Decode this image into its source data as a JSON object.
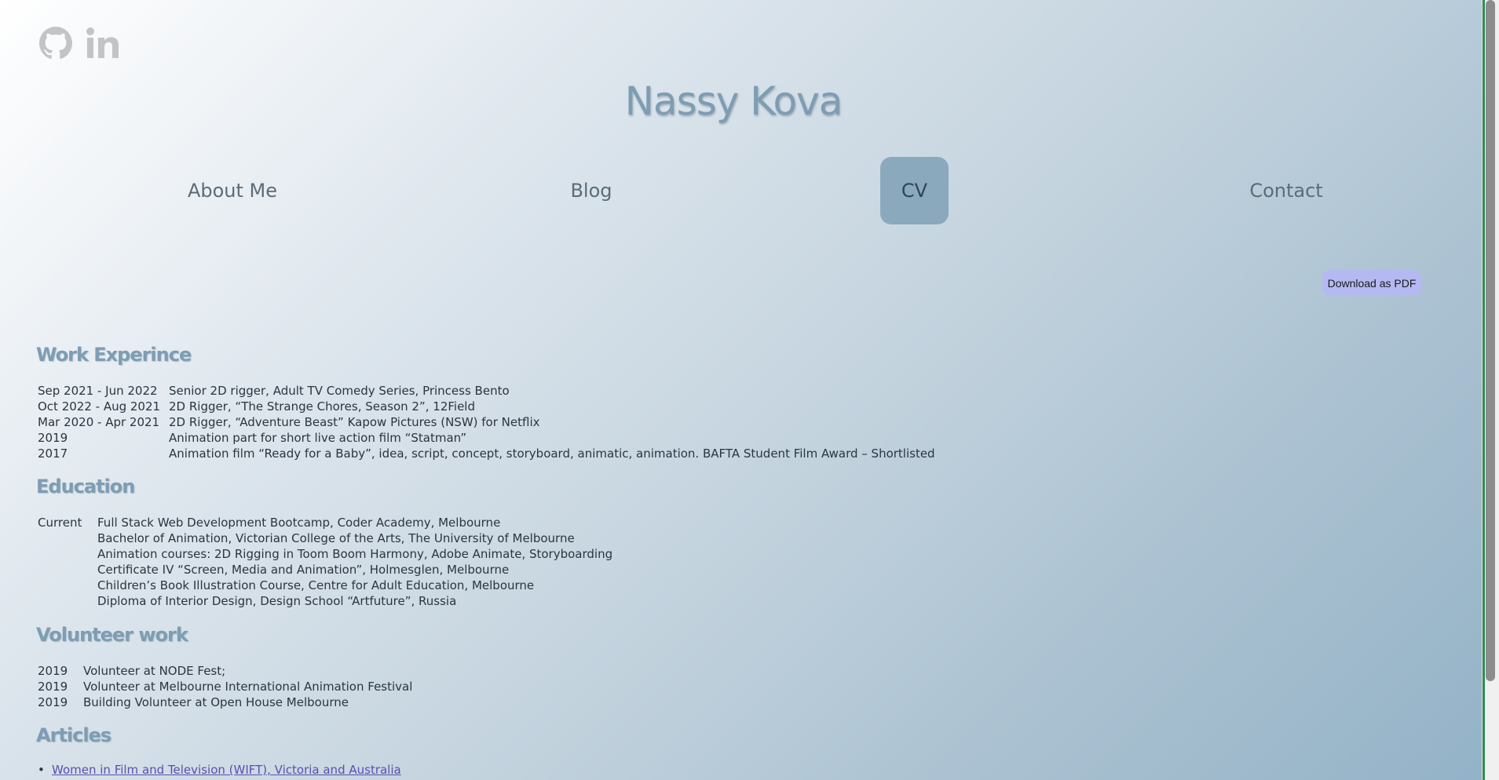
{
  "social": {
    "github_icon": "github-icon",
    "linkedin_icon": "linkedin-icon",
    "icon_color": "#c4c4c4"
  },
  "site_title": "Nassy Kova",
  "nav": {
    "items": [
      {
        "label": "About Me",
        "active": false
      },
      {
        "label": "Blog",
        "active": false
      },
      {
        "label": "CV",
        "active": true
      },
      {
        "label": "Contact",
        "active": false
      }
    ],
    "active_color": "#8aa9bd"
  },
  "download_pdf_label": "Download as PDF",
  "work": {
    "title": "Work Experince",
    "rows": [
      {
        "date": "Sep 2021 - Jun 2022",
        "text": "Senior 2D rigger, Adult TV Comedy Series, Princess Bento"
      },
      {
        "date": "Oct 2022 - Aug 2021",
        "text": "2D Rigger, “The Strange Chores, Season 2”, 12Field"
      },
      {
        "date": "Mar 2020 - Apr 2021",
        "text": "2D Rigger, “Adventure Beast” Kapow Pictures (NSW) for Netflix"
      },
      {
        "date": "2019",
        "text": "Animation part for short live action film “Statman”"
      },
      {
        "date": "2017",
        "text": "Animation film “Ready for a Baby”, idea, script, concept, storyboard, animatic, animation. BAFTA Student Film Award – Shortlisted"
      }
    ]
  },
  "education": {
    "title": "Education",
    "rows": [
      {
        "label": "Current",
        "text": "Full Stack Web Development Bootcamp, Coder Academy, Melbourne"
      },
      {
        "label": "",
        "text": "Bachelor of Animation, Victorian College of the Arts, The University of Melbourne"
      },
      {
        "label": "",
        "text": "Animation courses: 2D Rigging in Toom Boom Harmony, Adobe Animate, Storyboarding"
      },
      {
        "label": "",
        "text": "Certificate IV “Screen, Media and Animation”, Holmesglen, Melbourne"
      },
      {
        "label": "",
        "text": "Children’s Book Illustration Course, Centre for Adult Education, Melbourne"
      },
      {
        "label": "",
        "text": "Diploma of Interior Design, Design School “Artfuture”, Russia"
      }
    ]
  },
  "volunteer": {
    "title": "Volunteer work",
    "rows": [
      {
        "year": "2019",
        "text": "Volunteer at NODE Fest;"
      },
      {
        "year": "2019",
        "text": "Volunteer at Melbourne International Animation Festival"
      },
      {
        "year": "2019",
        "text": "Building Volunteer at Open House Melbourne"
      }
    ]
  },
  "articles": {
    "title": "Articles",
    "items": [
      {
        "label": "Women in Film and Television (WIFT), Victoria and Australia"
      }
    ]
  }
}
